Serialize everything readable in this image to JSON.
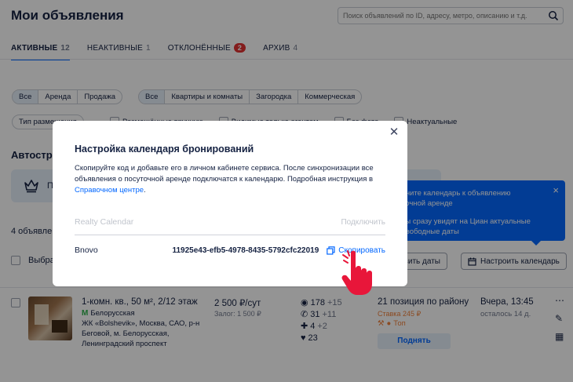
{
  "header": {
    "title": "Мои объявления",
    "search_placeholder": "Поиск объявлений по ID, адресу, метро, описанию и т.д."
  },
  "tabs": [
    {
      "label": "АКТИВНЫЕ",
      "count": "12",
      "active": true
    },
    {
      "label": "НЕАКТИВНЫЕ",
      "count": "1"
    },
    {
      "label": "ОТКЛОНЁННЫЕ",
      "badge": "2"
    },
    {
      "label": "АРХИВ",
      "count": "4"
    }
  ],
  "filters": {
    "deal": [
      "Все",
      "Аренда",
      "Продажа"
    ],
    "type": [
      "Все",
      "Квартиры и комнаты",
      "Загородка",
      "Коммерческая"
    ],
    "placement_label": "Тип размещения",
    "checks": [
      "Размещённые вручную",
      "Видимые только агентам",
      "Без фото",
      "Неактуальные"
    ]
  },
  "autostrategy": {
    "heading": "Автостра",
    "banner_letter": "П"
  },
  "list": {
    "count_text": "4 объявле",
    "select_all": "Выбра",
    "set_dates_btn": "овить даты",
    "calendar_btn": "Настроить календарь"
  },
  "tooltip": {
    "title": "очите календарь к объявлению\nточной аренде",
    "text": "ты сразу увидят на Циан актуальные\n свободные даты",
    "close": "×"
  },
  "listing": {
    "title": "1-комн. кв., 50 м², 2/12 этаж",
    "metro": "Белорусская",
    "address": "ЖК «Bolshevik», Москва, САО, р-н Беговой, м. Белорусская, Ленинградский проспект",
    "price": "2 500 ₽/сут",
    "deposit": "Залог: 1 500 ₽",
    "views": "178",
    "views_delta": "+15",
    "calls": "31",
    "calls_delta": "+11",
    "favs": "4",
    "favs_delta": "+2",
    "likes": "23",
    "position": "21 позиция по району",
    "rate": "Ставка 245 ₽",
    "top": "Топ",
    "raise_btn": "Поднять",
    "updated": "Вчера, 13:45",
    "remaining": "осталось 14 д."
  },
  "modal": {
    "title": "Настройка календаря бронирований",
    "desc_prefix": "Скопируйте код и добавьте его в личном кабинете сервиса. После синхронизации все объявления о посуточной аренде подключатся к календарю. Подробная инструкция в ",
    "desc_link": "Справочном центре",
    "desc_suffix": ".",
    "services": [
      {
        "name": "Realty Calendar",
        "action": "Подключить",
        "disabled": true
      },
      {
        "name": "Bnovo",
        "code": "11925e43-efb5-4978-8435-5792cfc22019",
        "action": "Скопировать"
      }
    ]
  },
  "colors": {
    "accent": "#0468ff",
    "text": "#152242",
    "badge": "#e23131",
    "hand": "#e8163a"
  }
}
